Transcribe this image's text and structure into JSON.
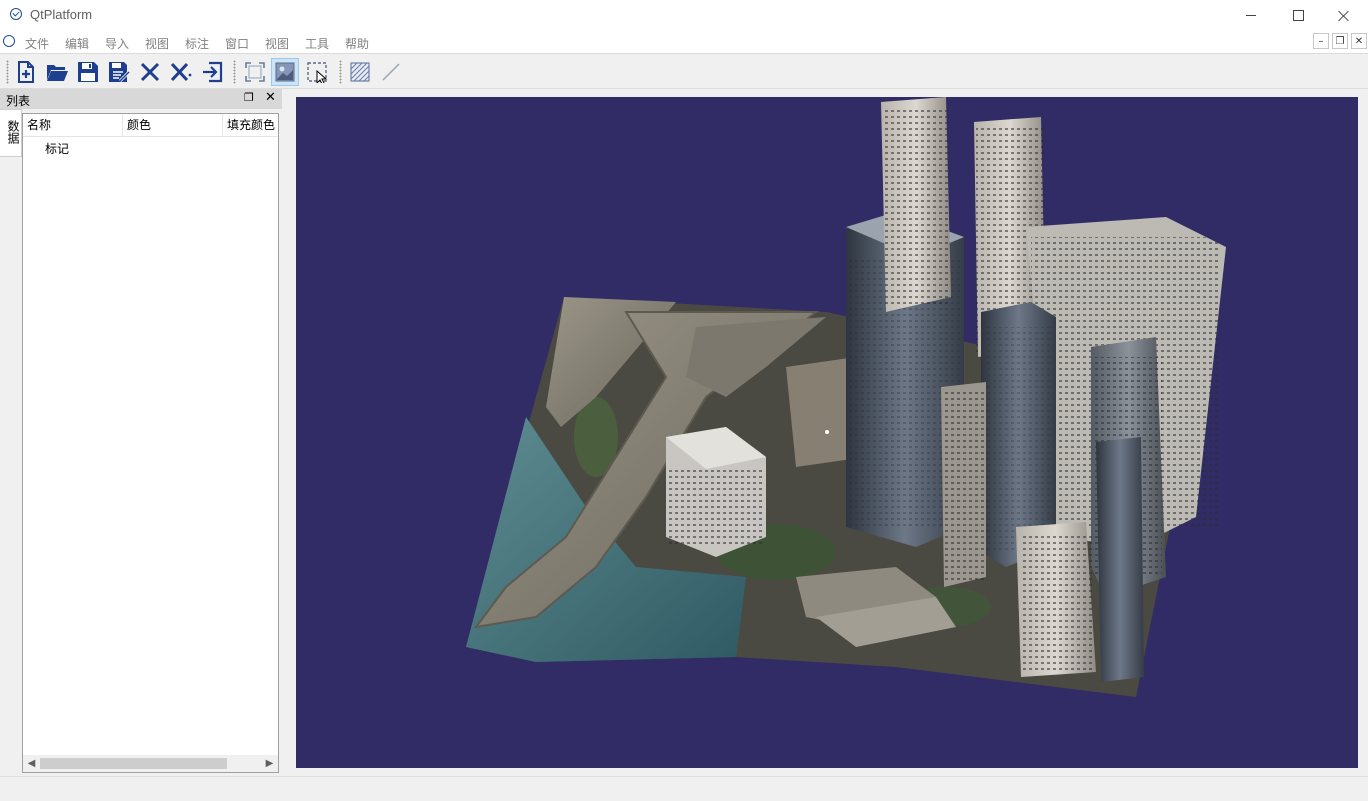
{
  "window": {
    "title": "QtPlatform"
  },
  "menu": {
    "items": [
      "文件",
      "编辑",
      "导入",
      "视图",
      "标注",
      "窗口",
      "视图",
      "工具",
      "帮助"
    ]
  },
  "toolbar": {
    "buttons": [
      {
        "icon": "new-file-icon"
      },
      {
        "icon": "open-folder-icon"
      },
      {
        "icon": "save-icon"
      },
      {
        "icon": "save-all-icon"
      },
      {
        "icon": "close-x-icon"
      },
      {
        "icon": "close-all-x-icon"
      },
      {
        "icon": "exit-icon"
      },
      {
        "icon": "frame-select-icon"
      },
      {
        "icon": "image-select-icon",
        "active": true
      },
      {
        "icon": "rect-select-icon"
      },
      {
        "icon": "hatch-fill-icon"
      },
      {
        "icon": "line-draw-icon"
      }
    ]
  },
  "dock": {
    "title": "列表",
    "side_tab": "数据",
    "columns": [
      "名称",
      "颜色",
      "填充颜色"
    ],
    "rows": [
      {
        "name": "标记"
      }
    ]
  },
  "viewport": {
    "background": "#312c66"
  }
}
